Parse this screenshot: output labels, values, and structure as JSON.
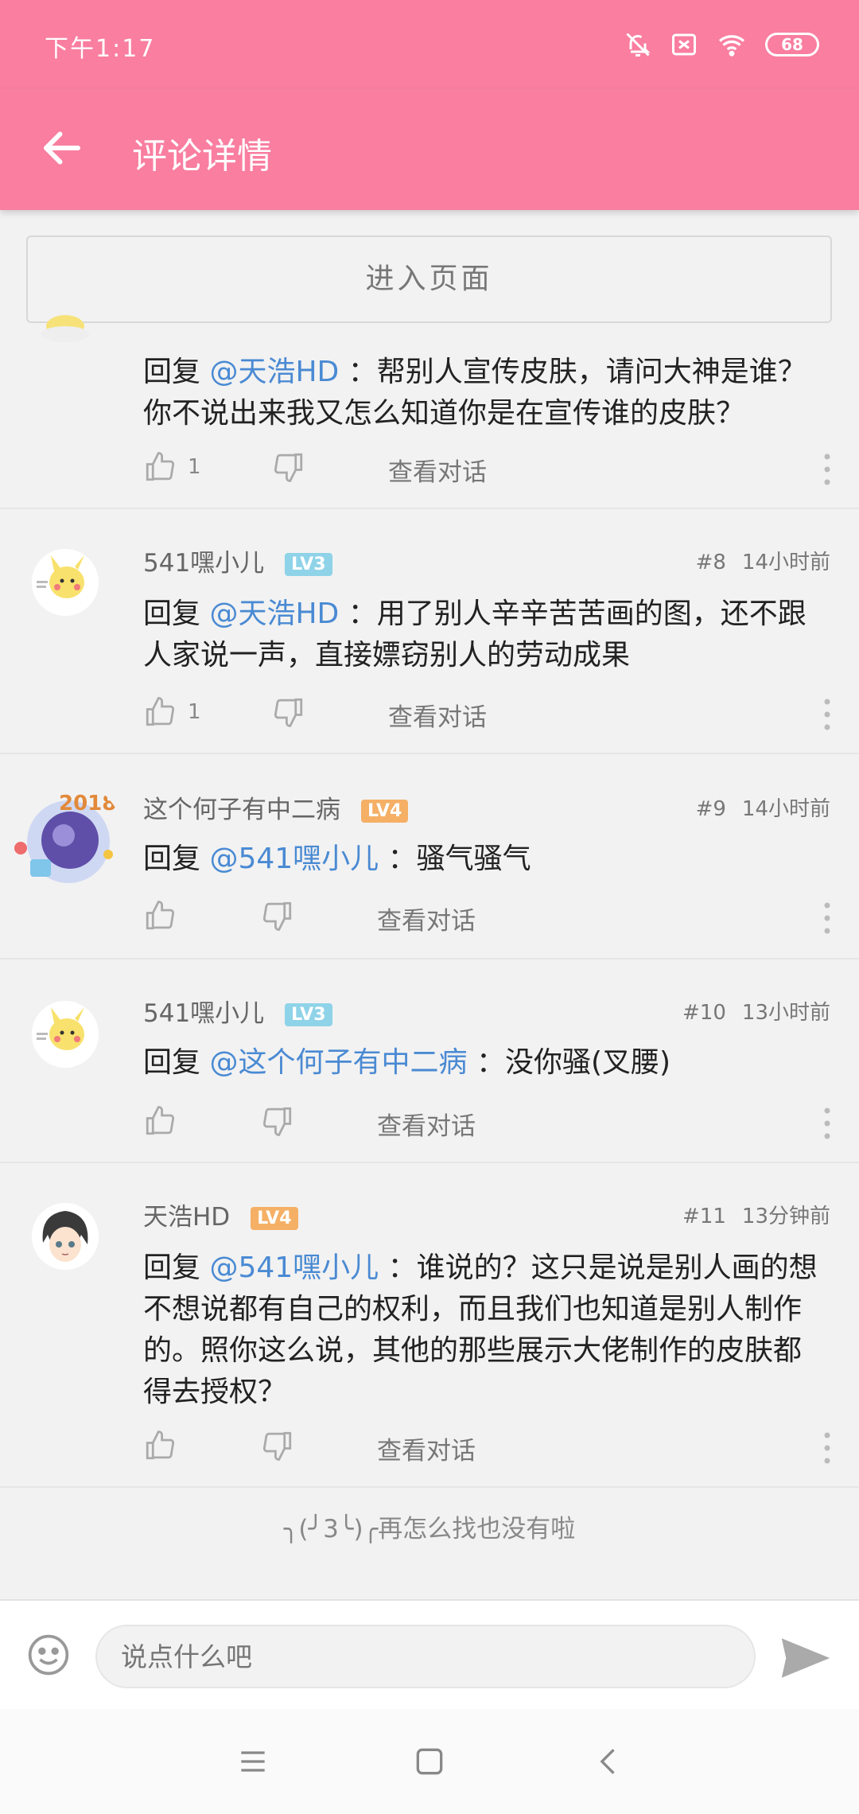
{
  "status_bar": {
    "time": "下午1:17",
    "battery": "68",
    "icons": [
      "bell-muted-icon",
      "sim-off-icon",
      "wifi-icon",
      "battery-icon"
    ]
  },
  "app_bar": {
    "title": "评论详情",
    "back_icon": "arrow-left-icon"
  },
  "enter_page_label": "进入页面",
  "comments": [
    {
      "username": "",
      "level": "",
      "floor": "",
      "time": "",
      "reply_prefix": "回复",
      "mention": "@天浩HD",
      "text": "：帮别人宣传皮肤，请问大神是谁？你不说出来我又怎么知道你是在宣传谁的皮肤？",
      "likes": "1",
      "view_conversation": "查看对话"
    },
    {
      "username": "541嘿小儿",
      "level": "LV3",
      "floor": "#8",
      "time": "14小时前",
      "reply_prefix": "回复",
      "mention": "@天浩HD",
      "text": "：用了别人辛辛苦苦画的图，还不跟人家说一声，直接嫖窃别人的劳动成果",
      "likes": "1",
      "view_conversation": "查看对话"
    },
    {
      "username": "这个何子有中二病",
      "level": "LV4",
      "floor": "#9",
      "time": "14小时前",
      "reply_prefix": "回复",
      "mention": "@541嘿小儿",
      "text": "：骚气骚气",
      "likes": "",
      "view_conversation": "查看对话"
    },
    {
      "username": "541嘿小儿",
      "level": "LV3",
      "floor": "#10",
      "time": "13小时前",
      "reply_prefix": "回复",
      "mention": "@这个何子有中二病",
      "text": "：没你骚(叉腰)",
      "likes": "",
      "view_conversation": "查看对话"
    },
    {
      "username": "天浩HD",
      "level": "LV4",
      "floor": "#11",
      "time": "13分钟前",
      "reply_prefix": "回复",
      "mention": "@541嘿小儿",
      "text": "：谁说的？这只是说是别人画的想不想说都有自己的权利，而且我们也知道是别人制作的。照你这么说，其他的那些展示大佬制作的皮肤都得去授权？",
      "likes": "",
      "view_conversation": "查看对话"
    }
  ],
  "end_message": "╮(╯3╰)╭再怎么找也没有啦",
  "input_bar": {
    "placeholder": "说点什么吧",
    "emoji_icon": "smiley-icon",
    "send_icon": "send-icon"
  },
  "nav_bar": {
    "icons": [
      "menu-icon",
      "home-square-icon",
      "back-chevron-icon"
    ]
  }
}
